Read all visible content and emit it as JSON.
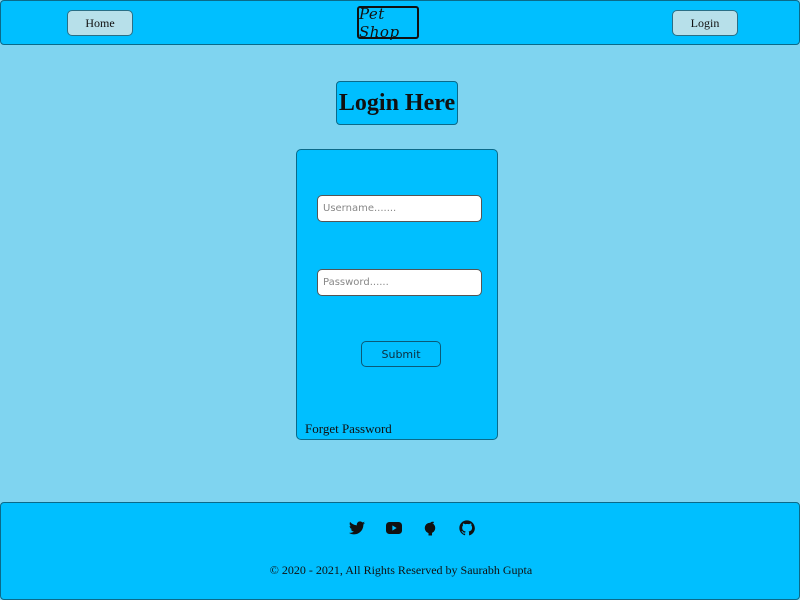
{
  "navbar": {
    "home_label": "Home",
    "logo_text": "Pet Shop",
    "login_label": "Login"
  },
  "page": {
    "heading": "Login Here"
  },
  "login_form": {
    "username_placeholder": "Username.......",
    "password_placeholder": "Password......",
    "submit_label": "Submit",
    "forget_label": "Forget Password"
  },
  "footer": {
    "social_icons": [
      "twitter-icon",
      "youtube-icon",
      "facebook-icon",
      "github-icon"
    ],
    "copyright": "© 2020 - 2021, All Rights Reserved by Saurabh Gupta"
  },
  "colors": {
    "background": "#7fd4f0",
    "accent": "#00bfff",
    "button_bg": "#b7e0ea"
  }
}
